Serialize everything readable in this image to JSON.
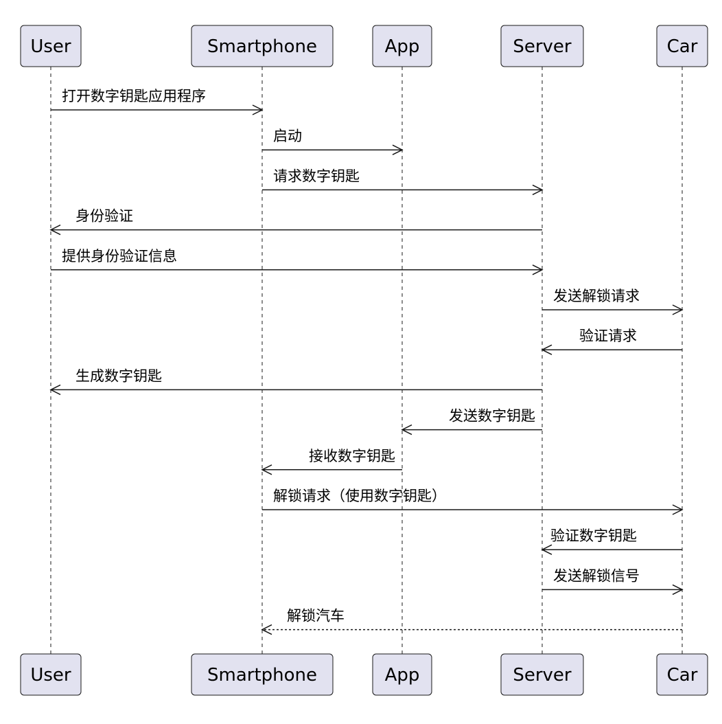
{
  "participants": [
    {
      "id": "user",
      "label": "User"
    },
    {
      "id": "smartphone",
      "label": "Smartphone"
    },
    {
      "id": "app",
      "label": "App"
    },
    {
      "id": "server",
      "label": "Server"
    },
    {
      "id": "car",
      "label": "Car"
    }
  ],
  "messages": [
    {
      "from": "user",
      "to": "smartphone",
      "label": "打开数字钥匙应用程序",
      "style": "solid"
    },
    {
      "from": "smartphone",
      "to": "app",
      "label": "启动",
      "style": "solid"
    },
    {
      "from": "smartphone",
      "to": "server",
      "label": "请求数字钥匙",
      "style": "solid"
    },
    {
      "from": "server",
      "to": "user",
      "label": "身份验证",
      "style": "solid"
    },
    {
      "from": "user",
      "to": "server",
      "label": "提供身份验证信息",
      "style": "solid"
    },
    {
      "from": "server",
      "to": "car",
      "label": "发送解锁请求",
      "style": "solid"
    },
    {
      "from": "car",
      "to": "server",
      "label": "验证请求",
      "style": "solid"
    },
    {
      "from": "server",
      "to": "user",
      "label": "生成数字钥匙",
      "style": "solid"
    },
    {
      "from": "server",
      "to": "app",
      "label": "发送数字钥匙",
      "style": "solid"
    },
    {
      "from": "app",
      "to": "smartphone",
      "label": "接收数字钥匙",
      "style": "solid"
    },
    {
      "from": "smartphone",
      "to": "car",
      "label": "解锁请求（使用数字钥匙）",
      "style": "solid"
    },
    {
      "from": "car",
      "to": "server",
      "label": "验证数字钥匙",
      "style": "solid"
    },
    {
      "from": "server",
      "to": "car",
      "label": "发送解锁信号",
      "style": "solid"
    },
    {
      "from": "car",
      "to": "smartphone",
      "label": "解锁汽车",
      "style": "dashed"
    }
  ],
  "colors": {
    "participant_fill": "#e2e2f0",
    "line": "#181818",
    "text": "#000000"
  }
}
